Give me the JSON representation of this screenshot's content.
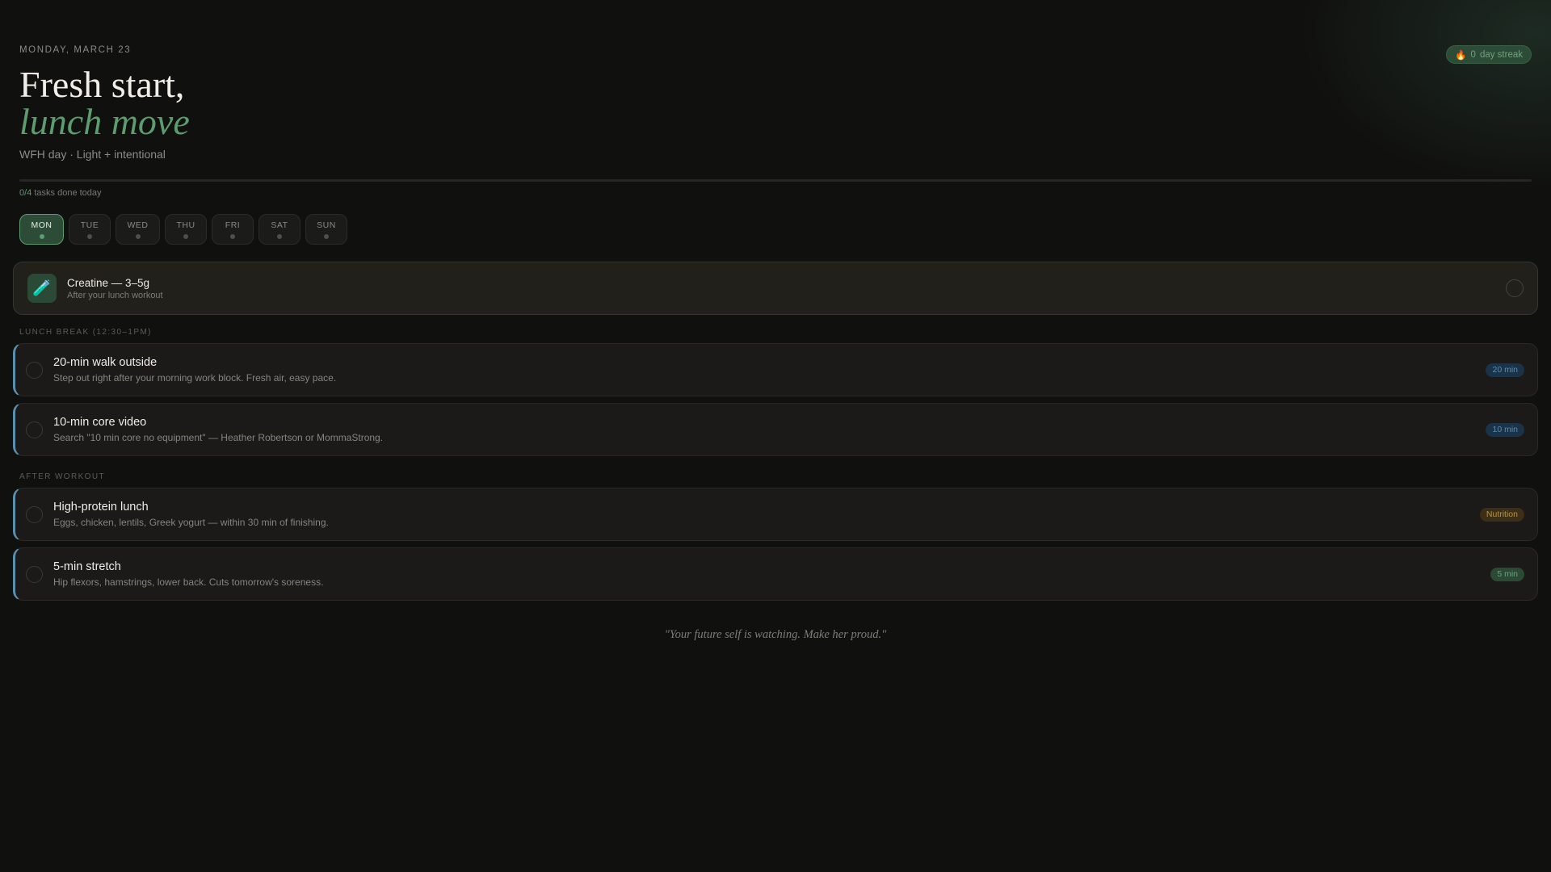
{
  "header": {
    "date": "MONDAY, MARCH 23",
    "title_line1": "Fresh start,",
    "title_line2": "lunch move",
    "subtitle": "WFH day · Light + intentional"
  },
  "streak": {
    "icon": "fire-icon",
    "glyph": "🔥",
    "count": "0",
    "label": "day streak"
  },
  "progress": {
    "done_text": "0/4",
    "label": "tasks done today",
    "fraction": 0
  },
  "days": [
    {
      "label": "MON",
      "active": true
    },
    {
      "label": "TUE"
    },
    {
      "label": "WED"
    },
    {
      "label": "THU"
    },
    {
      "label": "FRI"
    },
    {
      "label": "SAT"
    },
    {
      "label": "SUN"
    }
  ],
  "supplement": {
    "icon": "test-tube-icon",
    "glyph": "🧪",
    "title": "Creatine — 3–5g",
    "desc": "After your lunch workout"
  },
  "sections": [
    {
      "label": "LUNCH BREAK (12:30–1PM)",
      "tasks": [
        {
          "title": "20-min walk outside",
          "desc": "Step out right after your morning work block. Fresh air, easy pace.",
          "badge": "20 min"
        },
        {
          "title": "10-min core video",
          "desc": "Search \"10 min core no equipment\" — Heather Robertson or MommaStrong.",
          "badge": "10 min"
        }
      ]
    },
    {
      "label": "AFTER WORKOUT",
      "tasks": [
        {
          "title": "High-protein lunch",
          "desc": "Eggs, chicken, lentils, Greek yogurt — within 30 min of finishing.",
          "badge": "Nutrition"
        },
        {
          "title": "5-min stretch",
          "desc": "Hip flexors, hamstrings, lower back. Cuts tomorrow's soreness.",
          "badge": "5 min"
        }
      ]
    }
  ],
  "quote": "\"Your future self is watching. Make her proud.\""
}
